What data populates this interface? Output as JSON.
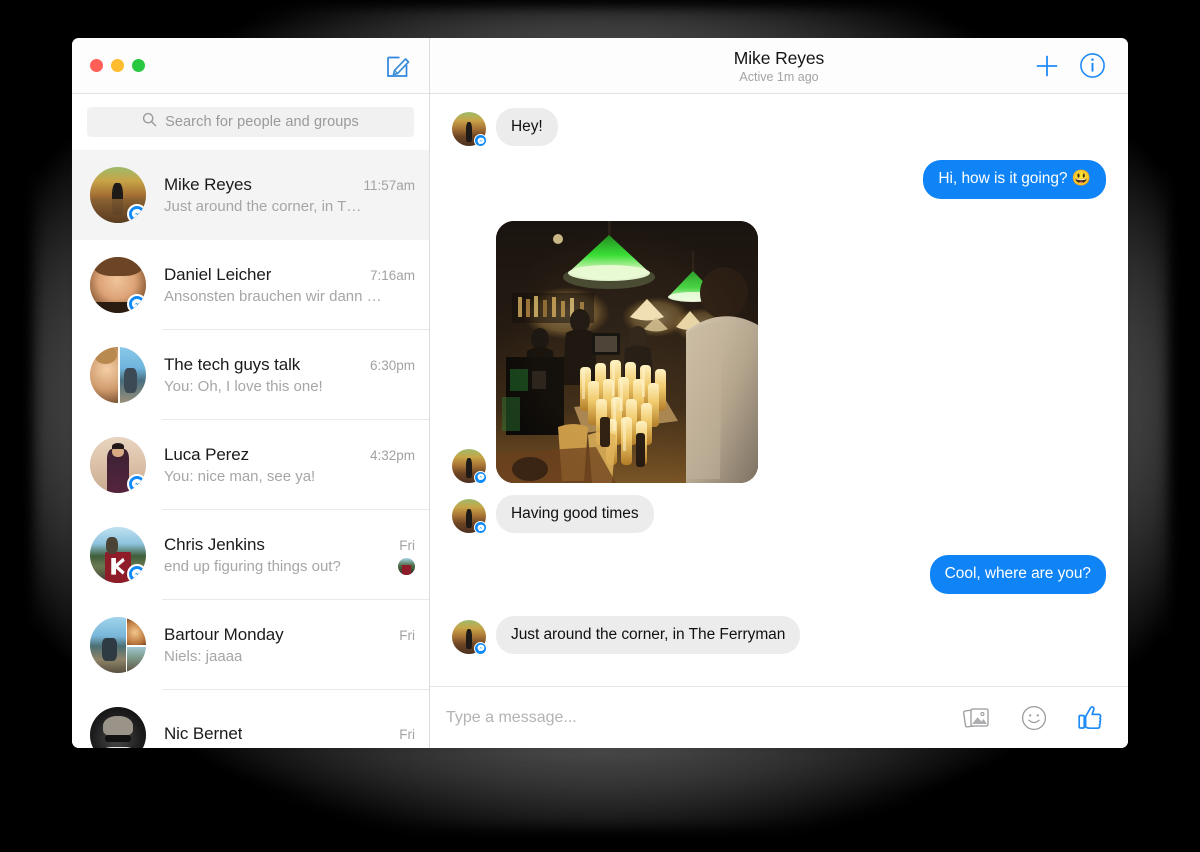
{
  "window": {
    "traffic_lights": [
      "close",
      "minimize",
      "zoom"
    ],
    "compose_label": "compose-new-message"
  },
  "search": {
    "placeholder": "Search for people and groups",
    "value": ""
  },
  "conversations": [
    {
      "name": "Mike Reyes",
      "time": "11:57am",
      "snippet": "Just around the corner, in T…",
      "active": true,
      "badge": "messenger",
      "avatar_type": "single",
      "seen_thumb": false
    },
    {
      "name": "Daniel Leicher",
      "time": "7:16am",
      "snippet": "Ansonsten brauchen wir dann …",
      "active": false,
      "badge": "messenger",
      "avatar_type": "single",
      "seen_thumb": false
    },
    {
      "name": "The tech guys talk",
      "time": "6:30pm",
      "snippet": "You: Oh, I love this one!",
      "active": false,
      "badge": "none",
      "avatar_type": "split2",
      "seen_thumb": false
    },
    {
      "name": "Luca Perez",
      "time": "4:32pm",
      "snippet": "You: nice man, see ya!",
      "active": false,
      "badge": "messenger",
      "avatar_type": "single",
      "seen_thumb": false
    },
    {
      "name": "Chris Jenkins",
      "time": "Fri",
      "snippet": "end up figuring things out?",
      "active": false,
      "badge": "messenger",
      "avatar_type": "single",
      "seen_thumb": true
    },
    {
      "name": "Bartour Monday",
      "time": "Fri",
      "snippet": "Niels: jaaaa",
      "active": false,
      "badge": "none",
      "avatar_type": "split3",
      "seen_thumb": false
    },
    {
      "name": "Nic Bernet",
      "time": "Fri",
      "snippet": "",
      "active": false,
      "badge": "none",
      "avatar_type": "single",
      "seen_thumb": false
    }
  ],
  "chat": {
    "title": "Mike Reyes",
    "subtitle": "Active 1m ago",
    "add_icon": "plus-icon",
    "info_icon": "info-icon",
    "messages": [
      {
        "id": "m1",
        "dir": "in",
        "type": "text",
        "text": "Hey!"
      },
      {
        "id": "m2",
        "dir": "out",
        "type": "text",
        "text": "Hi, how is it going? 😃"
      },
      {
        "id": "m3",
        "dir": "in",
        "type": "photo",
        "text": ""
      },
      {
        "id": "m4",
        "dir": "in",
        "type": "text",
        "text": "Having good times"
      },
      {
        "id": "m5",
        "dir": "out",
        "type": "text",
        "text": "Cool, where are you?"
      },
      {
        "id": "m6",
        "dir": "in",
        "type": "text",
        "text": "Just around the corner, in The Ferryman"
      }
    ]
  },
  "composer": {
    "placeholder": "Type a message...",
    "value": "",
    "actions": [
      "photo-icon",
      "sticker-smiley-icon",
      "thumbs-up-icon"
    ]
  },
  "colors": {
    "accent_blue": "#0f84f6",
    "incoming_bubble": "#ececec",
    "active_row": "#f4f4f4",
    "muted_text": "#a6a6a9"
  }
}
